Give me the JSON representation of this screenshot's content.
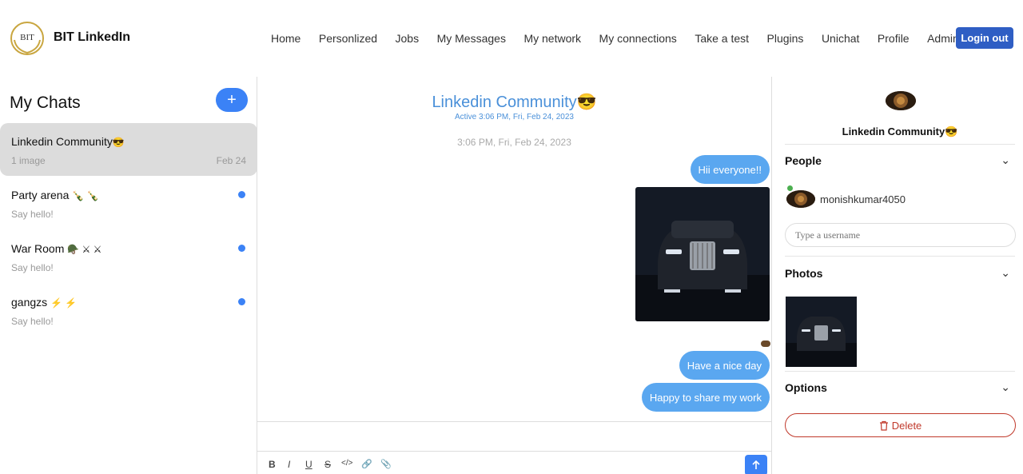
{
  "header": {
    "brand": "BIT LinkedIn",
    "logo_text": "BIT",
    "nav": [
      "Home",
      "Personlized",
      "Jobs",
      "My Messages",
      "My network",
      "My connections",
      "Take a test",
      "Plugins",
      "Unichat",
      "Profile",
      "Admin"
    ],
    "login_label": "Login out"
  },
  "sidebar": {
    "title": "My Chats",
    "add_label": "+",
    "chats": [
      {
        "name": "Linkedin Community",
        "emoji": "😎",
        "sub": "1 image",
        "date": "Feb 24",
        "active": true
      },
      {
        "name": "Party arena",
        "emoji": "🍾 🍾",
        "sub": "Say hello!",
        "date": "",
        "active": false
      },
      {
        "name": "War Room",
        "emoji": "🪖 ⚔ ⚔",
        "sub": "Say hello!",
        "date": "",
        "active": false
      },
      {
        "name": "gangzs",
        "emoji": "⚡ ⚡",
        "sub": "Say hello!",
        "date": "",
        "active": false
      }
    ]
  },
  "chat": {
    "title": "Linkedin Community",
    "title_emoji": "😎",
    "active": "Active 3:06 PM, Fri, Feb 24, 2023",
    "timestamp": "3:06 PM, Fri, Feb 24, 2023",
    "messages": [
      "Hii everyone!!",
      "Have a nice day",
      "Happy to share my work"
    ],
    "send_icon": "arrow-up-icon",
    "toolbar": [
      "B",
      "I",
      "U",
      "S",
      "</>",
      "🔗",
      "📎"
    ]
  },
  "right": {
    "group_name": "Linkedin Community",
    "group_emoji": "😎",
    "people_label": "People",
    "member": "monishkumar4050",
    "username_placeholder": "Type a username",
    "photos_label": "Photos",
    "options_label": "Options",
    "delete_label": "Delete"
  },
  "colors": {
    "primary": "#3b82f6",
    "bubble": "#5aa7f0",
    "login": "#2f5ec4",
    "danger": "#c0392b"
  }
}
